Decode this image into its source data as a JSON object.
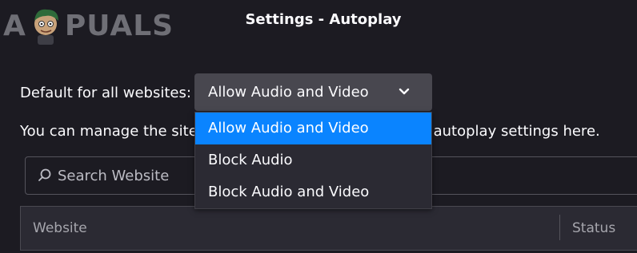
{
  "watermark": {
    "text_left": "A",
    "text_right": "PUALS"
  },
  "dialog": {
    "title": "Settings - Autoplay"
  },
  "default_setting": {
    "label": "Default for all websites:",
    "selected_value": "Allow Audio and Video",
    "options": [
      "Allow Audio and Video",
      "Block Audio",
      "Block Audio and Video"
    ],
    "highlighted_index": 0
  },
  "manage": {
    "text_before": "You can manage the sites that do not follow your default ",
    "text_visible_end": "autoplay settings here."
  },
  "search": {
    "placeholder": "Search Website"
  },
  "table": {
    "columns": [
      "Website",
      "Status"
    ]
  },
  "colors": {
    "accent": "#0a84ff",
    "background": "#1c1b22",
    "control": "#48474f",
    "panel": "#2b2a33"
  },
  "icons": {
    "search": "search-icon",
    "chevron": "chevron-down-icon"
  }
}
